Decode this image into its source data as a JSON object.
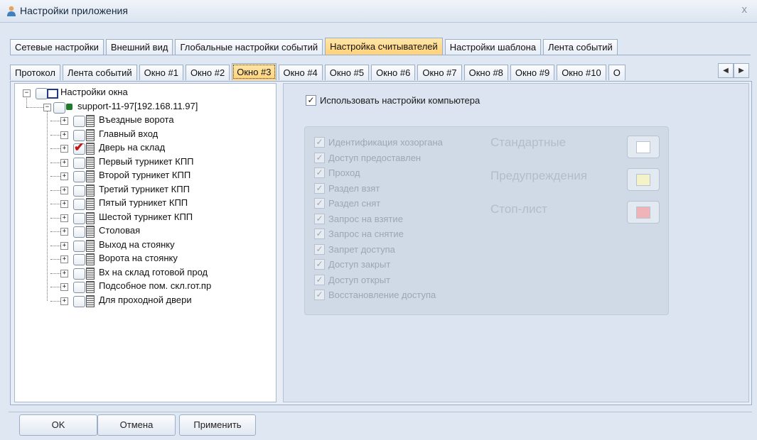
{
  "window": {
    "title": "Настройки приложения",
    "close_glyph": "x"
  },
  "main_tabs": [
    {
      "label": "Сетевые настройки",
      "active": false
    },
    {
      "label": "Внешний вид",
      "active": false
    },
    {
      "label": "Глобальные настройки событий",
      "active": false
    },
    {
      "label": "Настройка считывателей",
      "active": true
    },
    {
      "label": "Настройки шаблона",
      "active": false
    },
    {
      "label": "Лента событий",
      "active": false
    }
  ],
  "sub_tabs": [
    {
      "label": "Протокол",
      "active": false
    },
    {
      "label": "Лента событий",
      "active": false
    },
    {
      "label": "Окно #1",
      "active": false
    },
    {
      "label": "Окно #2",
      "active": false
    },
    {
      "label": "Окно #3",
      "active": true
    },
    {
      "label": "Окно #4",
      "active": false
    },
    {
      "label": "Окно #5",
      "active": false
    },
    {
      "label": "Окно #6",
      "active": false
    },
    {
      "label": "Окно #7",
      "active": false
    },
    {
      "label": "Окно #8",
      "active": false
    },
    {
      "label": "Окно #9",
      "active": false
    },
    {
      "label": "Окно #10",
      "active": false
    },
    {
      "label": "О",
      "active": false
    }
  ],
  "tree": {
    "root": "Настройки окна",
    "computer": "support-11-97[192.168.11.97]",
    "readers": [
      {
        "label": "Въездные ворота",
        "checked": false
      },
      {
        "label": "Главный вход",
        "checked": false
      },
      {
        "label": "Дверь на склад",
        "checked": true
      },
      {
        "label": "Первый турникет КПП",
        "checked": false
      },
      {
        "label": "Второй турникет КПП",
        "checked": false
      },
      {
        "label": "Третий турникет КПП",
        "checked": false
      },
      {
        "label": "Пятый турникет КПП",
        "checked": false
      },
      {
        "label": "Шестой турникет КПП",
        "checked": false
      },
      {
        "label": "Столовая",
        "checked": false
      },
      {
        "label": "Выход на стоянку",
        "checked": false
      },
      {
        "label": "Ворота на стоянку",
        "checked": false
      },
      {
        "label": "Вх на склад готовой прод",
        "checked": false
      },
      {
        "label": "Подсобное пом. скл.гот.пр",
        "checked": false
      },
      {
        "label": "Для проходной двери",
        "checked": false
      }
    ]
  },
  "settings": {
    "use_computer_label": "Использовать настройки компьютера",
    "use_computer_checked": true,
    "events": [
      "Идентификация хозоргана",
      "Доступ предоставлен",
      "Проход",
      "Раздел взят",
      "Раздел снят",
      "Запрос на взятие",
      "Запрос на снятие",
      "Запрет доступа",
      "Доступ закрыт",
      "Доступ открыт",
      "Восстановление доступа"
    ],
    "categories": [
      {
        "label": "Стандартные",
        "color": "#ffffff"
      },
      {
        "label": "Предупреждения",
        "color": "#f4f2c8"
      },
      {
        "label": "Стоп-лист",
        "color": "#f0b3b8"
      }
    ]
  },
  "buttons": {
    "ok": "OK",
    "cancel": "Отмена",
    "apply": "Применить"
  },
  "colors": {
    "active_tab": "#ffd27a",
    "checkmark": "#c81414"
  },
  "icons": {
    "window": "person-icon",
    "root_node": "window-icon",
    "computer_node": "computer-icon",
    "reader_node": "reader-icon",
    "scroll_left": "◀",
    "scroll_right": "▶",
    "checked_glyph": "✓",
    "check_red": "✔"
  }
}
